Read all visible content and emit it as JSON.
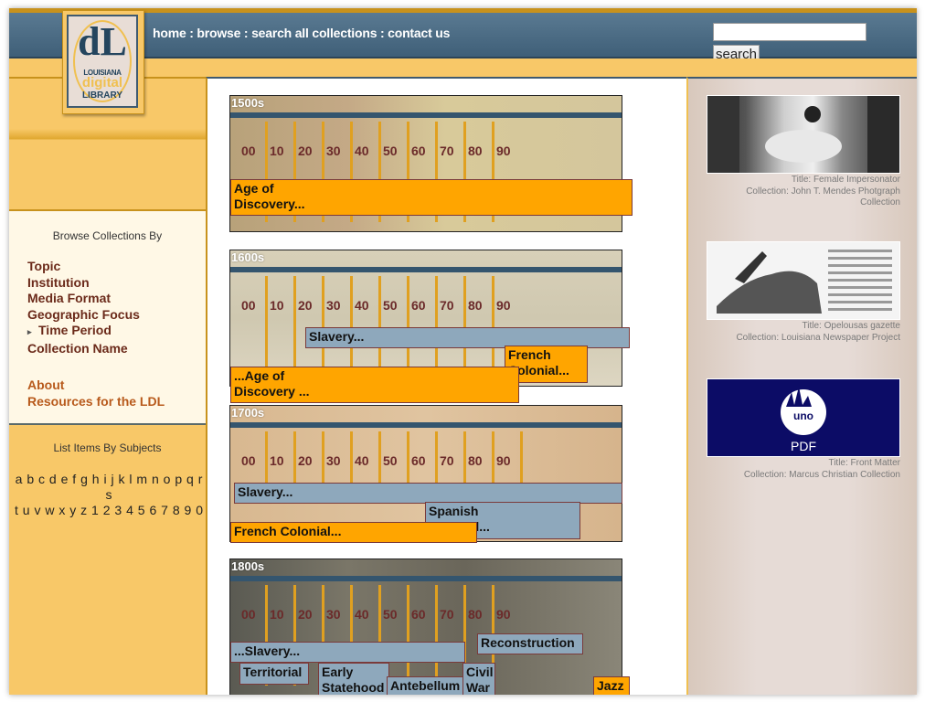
{
  "header": {
    "nav": [
      {
        "label": "home"
      },
      {
        "label": "browse"
      },
      {
        "label": "search all collections"
      },
      {
        "label": "contact us"
      }
    ],
    "separator": " : ",
    "search": {
      "value": "",
      "placeholder": "",
      "button_label": "search"
    }
  },
  "logo": {
    "glyph": "dL",
    "line1": "LOUISIANA",
    "line2": "digital",
    "line3": "LIBRARY"
  },
  "sidebar": {
    "browse_title": "Browse Collections By",
    "browse_items": [
      {
        "label": "Topic",
        "active": false
      },
      {
        "label": "Institution",
        "active": false
      },
      {
        "label": "Media Format",
        "active": false
      },
      {
        "label": "Geographic Focus",
        "active": false
      },
      {
        "label": "Time Period",
        "active": true
      },
      {
        "label": "Collection Name",
        "active": false
      }
    ],
    "active_marker": "▸",
    "links": [
      {
        "label": "About"
      },
      {
        "label": "Resources for the LDL"
      }
    ],
    "subjects_title": "List Items By Subjects",
    "alphabet": [
      "a",
      "b",
      "c",
      "d",
      "e",
      "f",
      "g",
      "h",
      "i",
      "j",
      "k",
      "l",
      "m",
      "n",
      "o",
      "p",
      "q",
      "r",
      "s",
      "t",
      "u",
      "v",
      "w",
      "x",
      "y",
      "z",
      "1",
      "2",
      "3",
      "4",
      "5",
      "6",
      "7",
      "8",
      "9",
      "0"
    ]
  },
  "timeline": {
    "decades": [
      "00",
      "10",
      "20",
      "30",
      "40",
      "50",
      "60",
      "70",
      "80",
      "90"
    ],
    "centuries": [
      {
        "label": "1500s",
        "bg": "manuscript",
        "eras": [
          {
            "line1": "Age of",
            "line2": "Discovery...",
            "color": "orange"
          }
        ]
      },
      {
        "label": "1600s",
        "bg": "map",
        "eras": [
          {
            "line1": "Slavery...",
            "line2": "",
            "color": "blue"
          },
          {
            "line1": "French",
            "line2": "Colonial...",
            "color": "orange"
          },
          {
            "line1": "...Age of",
            "line2": "Discovery ...",
            "color": "orange"
          }
        ]
      },
      {
        "label": "1700s",
        "bg": "handwriting",
        "eras": [
          {
            "line1": "Slavery...",
            "line2": "",
            "color": "blue"
          },
          {
            "line1": "Spanish",
            "line2": "Colonial...",
            "color": "blue"
          },
          {
            "line1": "French Colonial...",
            "line2": "",
            "color": "orange"
          }
        ]
      },
      {
        "label": "1800s",
        "bg": "photo",
        "eras": [
          {
            "line1": "Reconstruction",
            "line2": "",
            "color": "blue"
          },
          {
            "line1": "...Slavery...",
            "line2": "",
            "color": "blue"
          },
          {
            "line1": "Territorial",
            "line2": "",
            "color": "blue"
          },
          {
            "line1": "Early",
            "line2": "Statehood",
            "color": "blue"
          },
          {
            "line1": "Antebellum",
            "line2": "",
            "color": "blue"
          },
          {
            "line1": "Civil",
            "line2": "War",
            "color": "blue"
          },
          {
            "line1": "Jazz",
            "line2": "",
            "color": "orange"
          }
        ]
      }
    ]
  },
  "featured": [
    {
      "title": "Title: Female Impersonator",
      "collection": "Collection: John T. Mendes Photgraph Collection",
      "thumb": "photo"
    },
    {
      "title": "Title: Opelousas gazette",
      "collection": "Collection: Louisiana Newspaper Project",
      "thumb": "newspaper"
    },
    {
      "title": "Title: Front Matter",
      "collection": "Collection: Marcus Christian Collection",
      "thumb": "pdf",
      "thumb_label": "PDF",
      "thumb_badge": "uno"
    }
  ],
  "colors": {
    "header_blue": "#4a6a84",
    "gold": "#f8c868",
    "era_orange": "#ffa500",
    "era_blue": "#8ea8bc",
    "link_brown": "#6b2a1a"
  }
}
